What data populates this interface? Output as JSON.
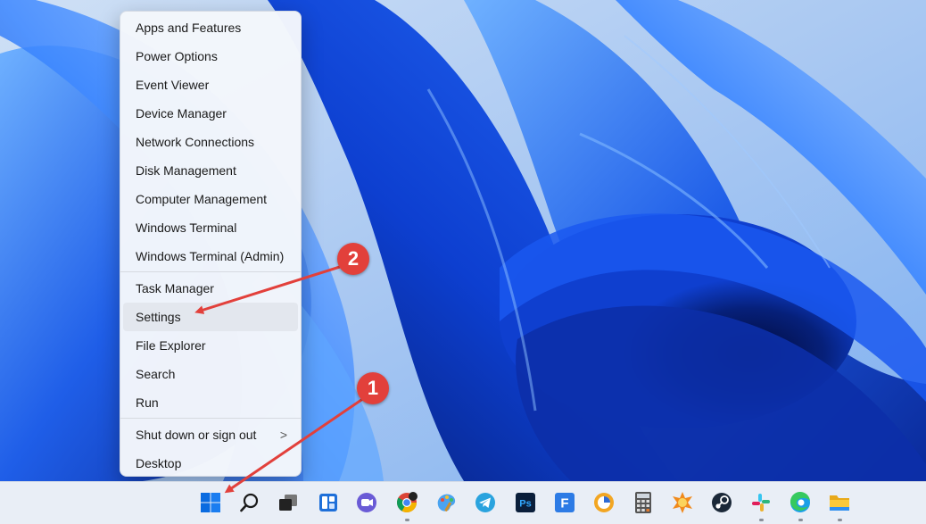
{
  "menu": {
    "items": [
      {
        "label": "Apps and Features"
      },
      {
        "label": "Power Options"
      },
      {
        "label": "Event Viewer"
      },
      {
        "label": "Device Manager"
      },
      {
        "label": "Network Connections"
      },
      {
        "label": "Disk Management"
      },
      {
        "label": "Computer Management"
      },
      {
        "label": "Windows Terminal"
      },
      {
        "label": "Windows Terminal (Admin)"
      },
      {
        "label": "Task Manager"
      },
      {
        "label": "Settings",
        "highlighted": true
      },
      {
        "label": "File Explorer"
      },
      {
        "label": "Search"
      },
      {
        "label": "Run"
      },
      {
        "label": "Shut down or sign out",
        "has_submenu": true
      },
      {
        "label": "Desktop"
      }
    ],
    "submenu_chevron": ">"
  },
  "annotations": {
    "step1": "1",
    "step2": "2",
    "arrow_color": "#e2403b"
  },
  "taskbar": {
    "icons": [
      {
        "name": "start-icon"
      },
      {
        "name": "search-icon"
      },
      {
        "name": "task-view-icon"
      },
      {
        "name": "widgets-icon"
      },
      {
        "name": "chat-icon"
      },
      {
        "name": "chrome-icon"
      },
      {
        "name": "paint-icon"
      },
      {
        "name": "telegram-icon"
      },
      {
        "name": "photoshop-icon",
        "label": "Ps"
      },
      {
        "name": "app-f-icon",
        "label": "F"
      },
      {
        "name": "app-c-icon"
      },
      {
        "name": "calculator-icon"
      },
      {
        "name": "xnview-icon"
      },
      {
        "name": "steam-icon"
      },
      {
        "name": "slack-icon"
      },
      {
        "name": "edge-icon"
      },
      {
        "name": "file-explorer-icon"
      }
    ]
  },
  "colors": {
    "wallpaper_dark": "#0b2fa0",
    "wallpaper_light": "#5aa0ff",
    "menu_bg": "#f3f6fb",
    "taskbar_bg": "#e9eef6"
  }
}
